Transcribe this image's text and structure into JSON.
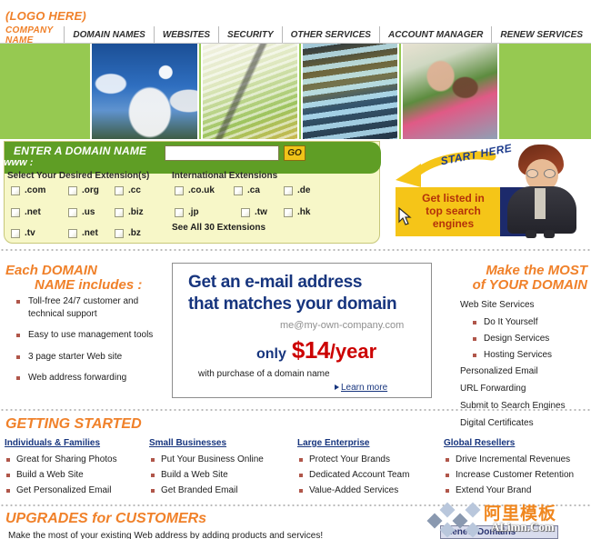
{
  "header": {
    "logo": "(LOGO HERE)",
    "company_name": "COMPANY NAME",
    "nav_items": [
      {
        "label": "DOMAIN NAMES"
      },
      {
        "label": "WEBSITES"
      },
      {
        "label": "SECURITY"
      },
      {
        "label": "OTHER SERVICES"
      },
      {
        "label": "ACCOUNT MANAGER"
      },
      {
        "label": "RENEW SERVICES"
      }
    ]
  },
  "hero": {
    "photos": [
      {
        "name": "satellite-dishes-photo"
      },
      {
        "name": "paperclip-photo"
      },
      {
        "name": "keyboard-photo"
      },
      {
        "name": "people-laptop-photo"
      }
    ]
  },
  "search": {
    "title": "ENTER A DOMAIN NAME",
    "www_prefix": "www :",
    "input_value": "",
    "input_placeholder": "",
    "go_label": "GO",
    "local_title": "Select Your Desired Extension(s)",
    "intl_title": "International Extensions",
    "local_extensions": [
      ".com",
      ".org",
      ".cc",
      ".net",
      ".us",
      ".biz",
      ".tv",
      ".net",
      ".bz"
    ],
    "intl_extensions": [
      ".co.uk",
      ".ca",
      ".de",
      ".jp",
      ".tw",
      ".hk"
    ],
    "see_all": "See All 30 Extensions"
  },
  "promo": {
    "start_here": "START HERE",
    "box_line1": "Get listed in",
    "box_line2": "top search",
    "box_line3": "engines"
  },
  "features": {
    "heading_line1": "Each DOMAIN",
    "heading_line2": "NAME includes :",
    "items": [
      "Toll-free 24/7 customer and technical support",
      "Easy to use management tools",
      "3 page starter Web site",
      "Web address forwarding"
    ]
  },
  "email_promo": {
    "line1": "Get an e-mail address",
    "line2": "that matches your domain",
    "sample_address": "me@my-own-company.com",
    "only_label": "only",
    "amount": "$14",
    "per": "/year",
    "note": "with purchase of a domain name",
    "learn_more": "Learn more"
  },
  "services": {
    "heading_line1": "Make the MOST",
    "heading_line2": "of YOUR DOMAIN",
    "web_site_services": "Web Site Services",
    "sub_items": [
      "Do It Yourself",
      "Design Services",
      "Hosting Services"
    ],
    "items": [
      "Personalized Email",
      "URL Forwarding",
      "Submit to Search Engines",
      "Digital Certificates"
    ]
  },
  "getting_started": {
    "title": "GETTING STARTED",
    "columns": [
      {
        "heading": "Individuals & Families",
        "items": [
          "Great for Sharing Photos",
          "Build a Web Site",
          "Get Personalized Email"
        ]
      },
      {
        "heading": "Small Businesses",
        "items": [
          "Put Your Business Online",
          "Build a Web Site",
          "Get Branded Email"
        ]
      },
      {
        "heading": "Large Enterprise",
        "items": [
          "Protect Your Brands",
          "Dedicated Account Team",
          "Value-Added Services"
        ]
      },
      {
        "heading": "Global Resellers",
        "items": [
          "Drive Incremental Revenues",
          "Increase Customer Retention",
          "Extend Your Brand"
        ]
      }
    ]
  },
  "upgrades": {
    "title": "UPGRADES for CUSTOMERs",
    "subtitle": "Make the most of your existing Web address by adding products and services!",
    "renew_button": "Renew Domains"
  },
  "watermark": {
    "chinese": "阿里模板",
    "english": "ALimn.Com"
  },
  "colors": {
    "orange": "#f0812a",
    "green": "#5f9e25",
    "hero_green": "#96c951",
    "panel_yellow": "#f7f7c8",
    "navy": "#17357e",
    "red": "#cc0000",
    "gold": "#f0c419",
    "promo_yellow": "#f5c518"
  }
}
